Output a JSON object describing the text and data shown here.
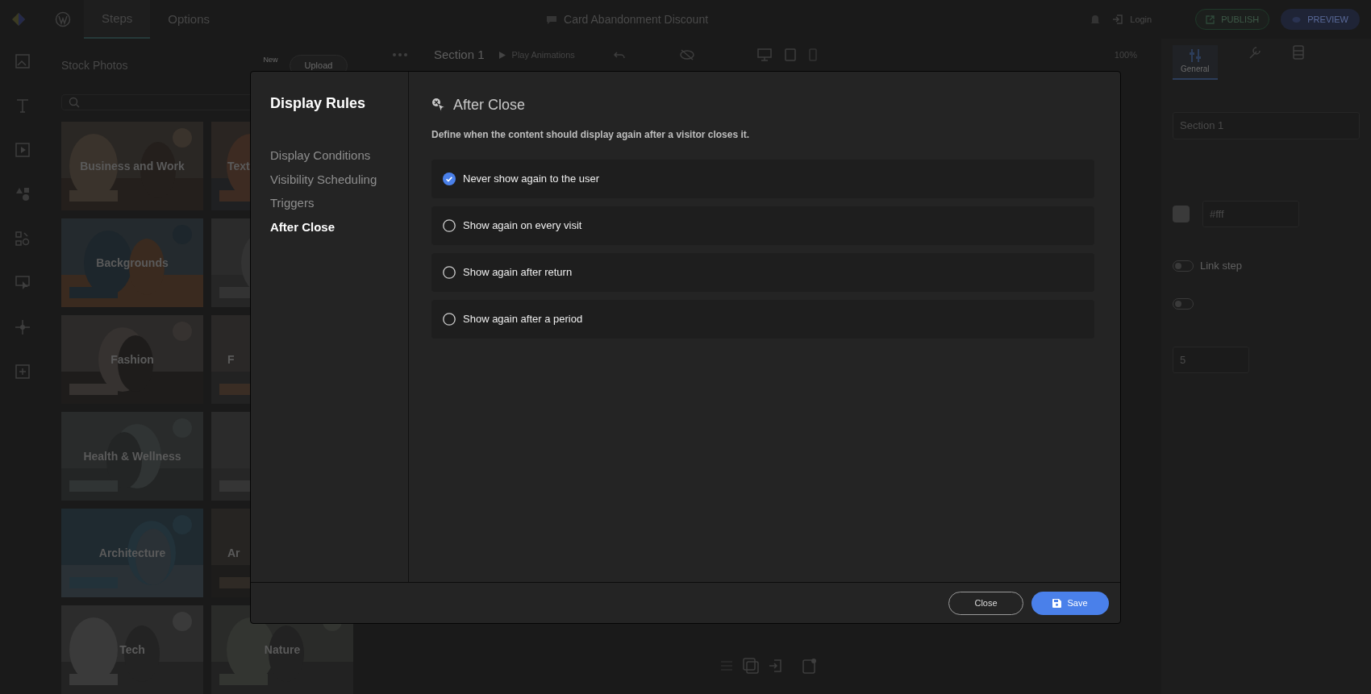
{
  "topbar": {
    "tabs": [
      {
        "label": "Steps",
        "selected": true
      },
      {
        "label": "Options",
        "selected": false
      }
    ],
    "document_title": "Card Abandonment Discount",
    "login": "Login",
    "publish": "PUBLISH",
    "preview": "PREVIEW"
  },
  "stock_photos": {
    "title": "Stock Photos",
    "new_badge": "New",
    "upload": "Upload",
    "categories": [
      {
        "label": "Business and Work",
        "kind": "full"
      },
      {
        "label": "Text",
        "kind": "partial"
      },
      {
        "label": "Backgrounds",
        "kind": "full"
      },
      {
        "kind": "picture"
      },
      {
        "label": "Fashion",
        "kind": "full"
      },
      {
        "label": "F",
        "kind": "partial"
      },
      {
        "label": "Health & Wellness",
        "kind": "full"
      },
      {
        "kind": "picture"
      },
      {
        "label": "Architecture",
        "kind": "full"
      },
      {
        "label": "Ar",
        "kind": "partial"
      },
      {
        "label": "Tech",
        "kind": "full"
      },
      {
        "label": "Nature",
        "kind": "full"
      }
    ]
  },
  "canvas": {
    "section": "Section 1",
    "play": "Play Animations",
    "zoom": "100%"
  },
  "settings_panel": {
    "tabs": [
      {
        "label": "General",
        "selected": true
      }
    ],
    "step_name": "Section 1",
    "background_color": "#fff",
    "toggles": [
      {
        "label": "Link step",
        "on": false
      },
      {
        "on": false
      }
    ],
    "duration": "5"
  },
  "modal": {
    "title": "Display Rules",
    "nav": [
      {
        "label": "Display Conditions",
        "selected": false
      },
      {
        "label": "Visibility Scheduling",
        "selected": false
      },
      {
        "label": "Triggers",
        "selected": false
      },
      {
        "label": "After Close",
        "selected": true
      }
    ],
    "section_title": "After Close",
    "description": "Define when the content should display again after a visitor closes it.",
    "options": [
      {
        "label": "Never show again to the user",
        "selected": true
      },
      {
        "label": "Show again on every visit",
        "selected": false
      },
      {
        "label": "Show again after return",
        "selected": false
      },
      {
        "label": "Show again after a period",
        "selected": false
      }
    ],
    "buttons": [
      {
        "label": "Close",
        "kind": "secondary"
      },
      {
        "label": "Save",
        "kind": "primary"
      }
    ]
  }
}
